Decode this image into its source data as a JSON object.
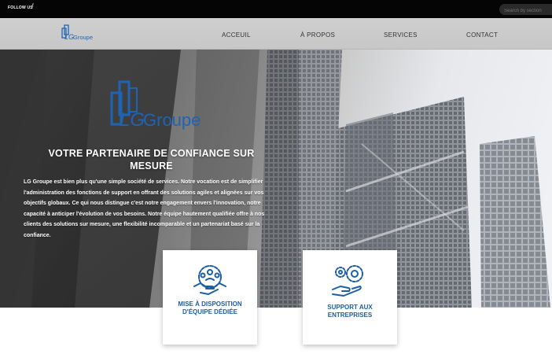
{
  "topbar": {
    "follow_label": "FOLLOW US",
    "social_icon": "facebook-icon",
    "search_placeholder": "Search by section"
  },
  "brand": {
    "logo_text_lg": "LG",
    "logo_text_groupe": "Groupe",
    "color": "#1f64b4"
  },
  "nav": {
    "items": [
      {
        "label": "ACCEUIL"
      },
      {
        "label": "À PROPOS"
      },
      {
        "label": "SERVICES"
      },
      {
        "label": "CONTACT"
      }
    ]
  },
  "hero": {
    "title": "VOTRE PARTENAIRE DE CONFIANCE SUR MESURE",
    "description": "LG Groupe est bien plus qu'une simple société de services. Notre vocation est de simplifier l'administration des fonctions de support en offrant des solutions agiles et alignées sur vos objectifs globaux. Ce qui nous distingue c'est notre engagement envers l'innovation, notre capacité à anticiper l'évolution de vos besoins. Notre équipe hautement qualifiée offre à nos clients des solutions sur mesure, une flexibilité incomparable et un partenariat basé sur la confiance."
  },
  "services": [
    {
      "icon": "team-handshake-icon",
      "label": "MISE À DISPOSITION D'ÉQUIPE DÉDIÉE"
    },
    {
      "icon": "gears-support-icon",
      "label": "SUPPORT AUX ENTREPRISES"
    }
  ],
  "colors": {
    "accent": "#1d5fa3",
    "topbar": "#050505",
    "navbar": "#cbcbcb"
  }
}
